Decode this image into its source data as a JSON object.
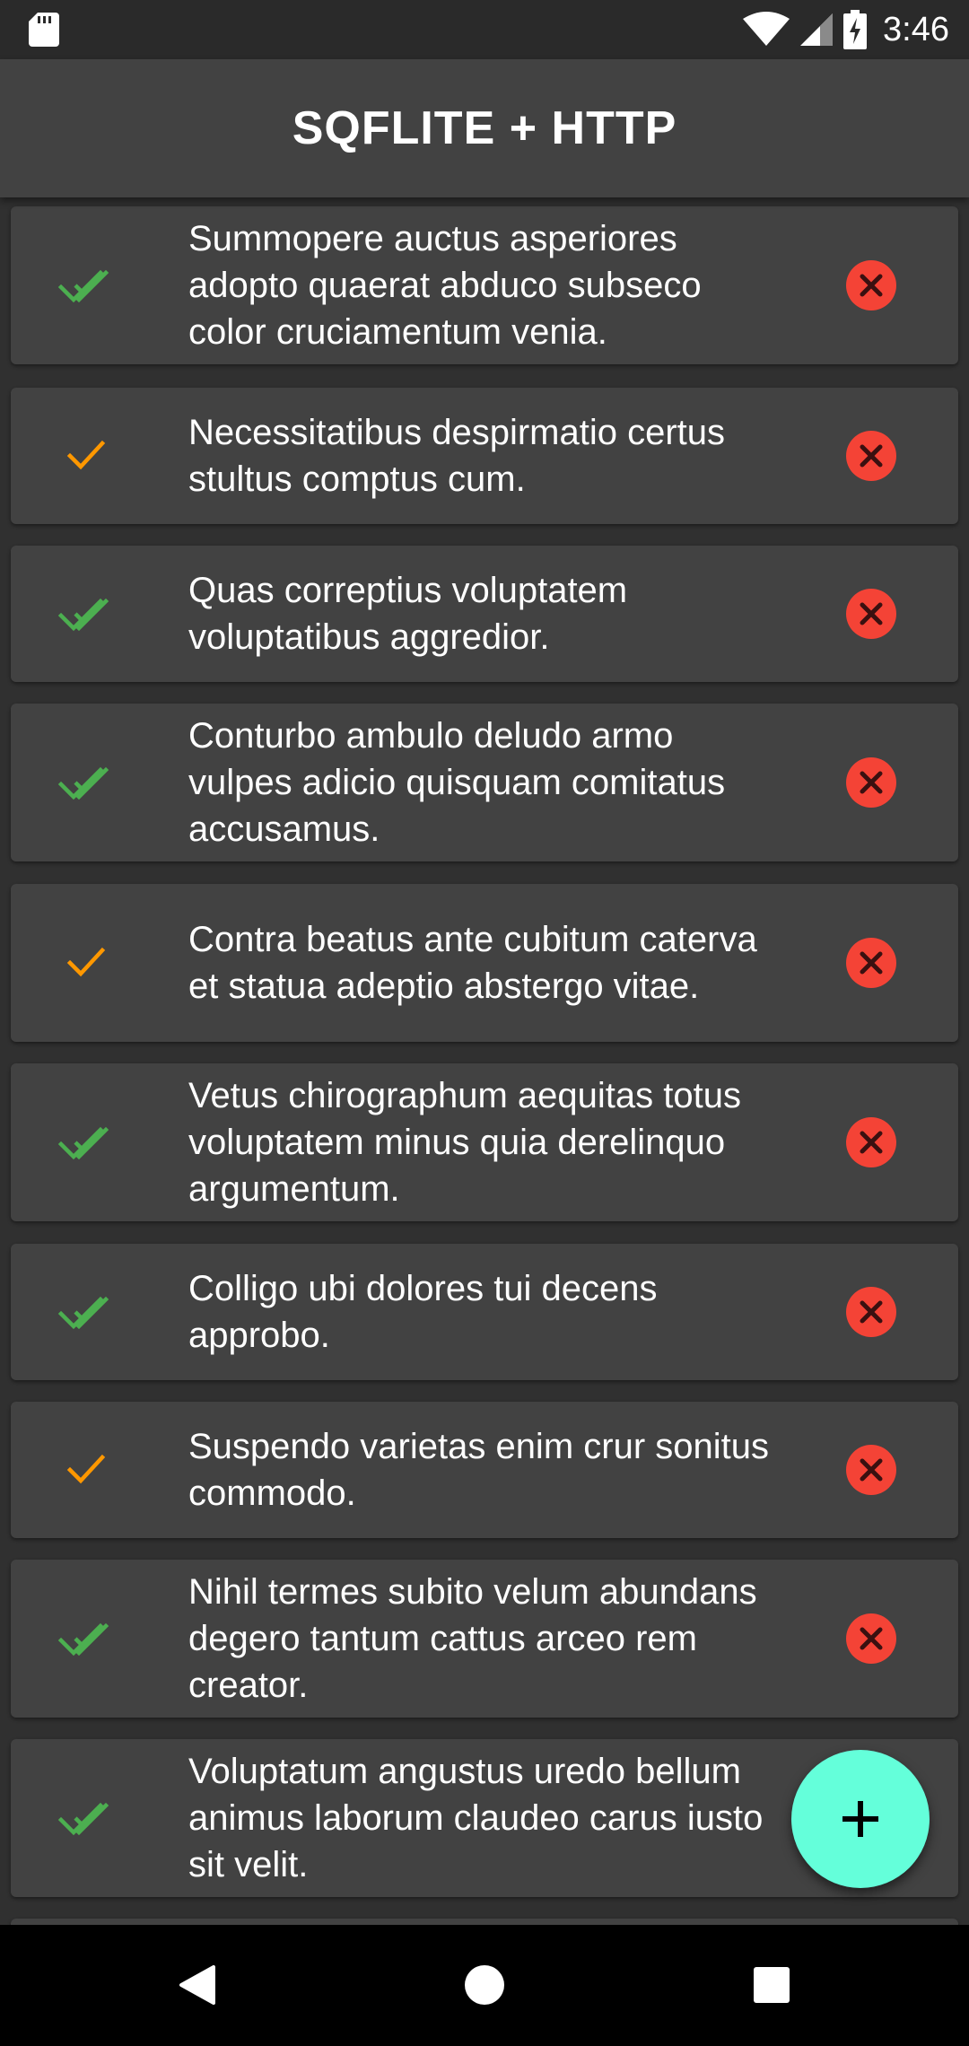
{
  "status_bar": {
    "time": "3:46",
    "icons": [
      "sd-card-icon",
      "wifi-icon",
      "signal-icon",
      "battery-charging-icon"
    ]
  },
  "app_bar": {
    "title": "SQFLITE + HTTP"
  },
  "colors": {
    "done": "#4caf50",
    "pending": "#ff9800",
    "delete": "#f44336",
    "fab": "#64ffda",
    "card": "#424242",
    "background": "#303030"
  },
  "todos": [
    {
      "text": "Summopere auctus asperiores adopto quaerat abduco subseco color cruciamentum venia.",
      "status": "done-all-icon"
    },
    {
      "text": "Necessitatibus despirmatio certus stultus comptus cum.",
      "status": "check-icon"
    },
    {
      "text": "Quas correptius voluptatem voluptatibus aggredior.",
      "status": "done-all-icon"
    },
    {
      "text": "Conturbo ambulo deludo armo vulpes adicio quisquam comitatus accusamus.",
      "status": "done-all-icon"
    },
    {
      "text": "Contra beatus ante cubitum caterva et statua adeptio abstergo vitae.",
      "status": "check-icon"
    },
    {
      "text": "Vetus chirographum aequitas totus voluptatem minus quia derelinquo argumentum.",
      "status": "done-all-icon"
    },
    {
      "text": "Colligo ubi dolores tui decens approbo.",
      "status": "done-all-icon"
    },
    {
      "text": "Suspendo varietas enim crur sonitus commodo.",
      "status": "check-icon"
    },
    {
      "text": "Nihil termes subito velum abundans degero tantum cattus arceo rem creator.",
      "status": "done-all-icon"
    },
    {
      "text": "Voluptatum angustus uredo bellum animus laborum claudeo carus iusto sit velit.",
      "status": "done-all-icon"
    }
  ],
  "fab": {
    "icon": "add-icon"
  },
  "nav_bar": {
    "icons": [
      "back-icon",
      "home-icon",
      "recents-icon"
    ]
  }
}
